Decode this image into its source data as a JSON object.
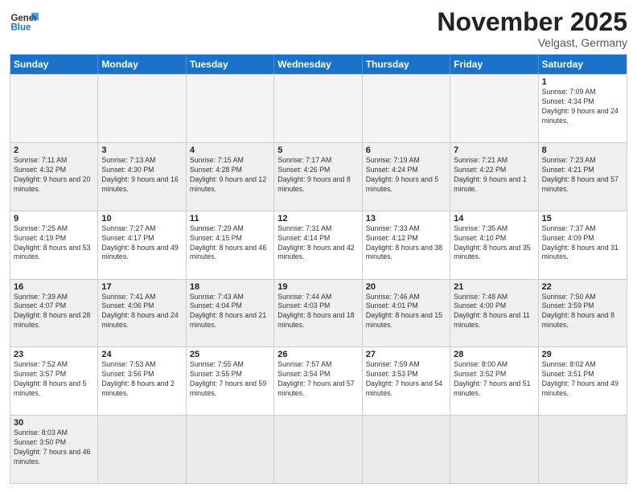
{
  "logo": {
    "general": "General",
    "blue": "Blue"
  },
  "header": {
    "month": "November 2025",
    "location": "Velgast, Germany"
  },
  "days_of_week": [
    "Sunday",
    "Monday",
    "Tuesday",
    "Wednesday",
    "Thursday",
    "Friday",
    "Saturday"
  ],
  "weeks": [
    [
      {
        "day": "",
        "info": ""
      },
      {
        "day": "",
        "info": ""
      },
      {
        "day": "",
        "info": ""
      },
      {
        "day": "",
        "info": ""
      },
      {
        "day": "",
        "info": ""
      },
      {
        "day": "",
        "info": ""
      },
      {
        "day": "1",
        "info": "Sunrise: 7:09 AM\nSunset: 4:34 PM\nDaylight: 9 hours and 24 minutes."
      }
    ],
    [
      {
        "day": "2",
        "info": "Sunrise: 7:11 AM\nSunset: 4:32 PM\nDaylight: 9 hours and 20 minutes."
      },
      {
        "day": "3",
        "info": "Sunrise: 7:13 AM\nSunset: 4:30 PM\nDaylight: 9 hours and 16 minutes."
      },
      {
        "day": "4",
        "info": "Sunrise: 7:15 AM\nSunset: 4:28 PM\nDaylight: 9 hours and 12 minutes."
      },
      {
        "day": "5",
        "info": "Sunrise: 7:17 AM\nSunset: 4:26 PM\nDaylight: 9 hours and 8 minutes."
      },
      {
        "day": "6",
        "info": "Sunrise: 7:19 AM\nSunset: 4:24 PM\nDaylight: 9 hours and 5 minutes."
      },
      {
        "day": "7",
        "info": "Sunrise: 7:21 AM\nSunset: 4:22 PM\nDaylight: 9 hours and 1 minute."
      },
      {
        "day": "8",
        "info": "Sunrise: 7:23 AM\nSunset: 4:21 PM\nDaylight: 8 hours and 57 minutes."
      }
    ],
    [
      {
        "day": "9",
        "info": "Sunrise: 7:25 AM\nSunset: 4:19 PM\nDaylight: 8 hours and 53 minutes."
      },
      {
        "day": "10",
        "info": "Sunrise: 7:27 AM\nSunset: 4:17 PM\nDaylight: 8 hours and 49 minutes."
      },
      {
        "day": "11",
        "info": "Sunrise: 7:29 AM\nSunset: 4:15 PM\nDaylight: 8 hours and 46 minutes."
      },
      {
        "day": "12",
        "info": "Sunrise: 7:31 AM\nSunset: 4:14 PM\nDaylight: 8 hours and 42 minutes."
      },
      {
        "day": "13",
        "info": "Sunrise: 7:33 AM\nSunset: 4:12 PM\nDaylight: 8 hours and 38 minutes."
      },
      {
        "day": "14",
        "info": "Sunrise: 7:35 AM\nSunset: 4:10 PM\nDaylight: 8 hours and 35 minutes."
      },
      {
        "day": "15",
        "info": "Sunrise: 7:37 AM\nSunset: 4:09 PM\nDaylight: 8 hours and 31 minutes."
      }
    ],
    [
      {
        "day": "16",
        "info": "Sunrise: 7:39 AM\nSunset: 4:07 PM\nDaylight: 8 hours and 28 minutes."
      },
      {
        "day": "17",
        "info": "Sunrise: 7:41 AM\nSunset: 4:06 PM\nDaylight: 8 hours and 24 minutes."
      },
      {
        "day": "18",
        "info": "Sunrise: 7:43 AM\nSunset: 4:04 PM\nDaylight: 8 hours and 21 minutes."
      },
      {
        "day": "19",
        "info": "Sunrise: 7:44 AM\nSunset: 4:03 PM\nDaylight: 8 hours and 18 minutes."
      },
      {
        "day": "20",
        "info": "Sunrise: 7:46 AM\nSunset: 4:01 PM\nDaylight: 8 hours and 15 minutes."
      },
      {
        "day": "21",
        "info": "Sunrise: 7:48 AM\nSunset: 4:00 PM\nDaylight: 8 hours and 11 minutes."
      },
      {
        "day": "22",
        "info": "Sunrise: 7:50 AM\nSunset: 3:59 PM\nDaylight: 8 hours and 8 minutes."
      }
    ],
    [
      {
        "day": "23",
        "info": "Sunrise: 7:52 AM\nSunset: 3:57 PM\nDaylight: 8 hours and 5 minutes."
      },
      {
        "day": "24",
        "info": "Sunrise: 7:53 AM\nSunset: 3:56 PM\nDaylight: 8 hours and 2 minutes."
      },
      {
        "day": "25",
        "info": "Sunrise: 7:55 AM\nSunset: 3:55 PM\nDaylight: 7 hours and 59 minutes."
      },
      {
        "day": "26",
        "info": "Sunrise: 7:57 AM\nSunset: 3:54 PM\nDaylight: 7 hours and 57 minutes."
      },
      {
        "day": "27",
        "info": "Sunrise: 7:59 AM\nSunset: 3:53 PM\nDaylight: 7 hours and 54 minutes."
      },
      {
        "day": "28",
        "info": "Sunrise: 8:00 AM\nSunset: 3:52 PM\nDaylight: 7 hours and 51 minutes."
      },
      {
        "day": "29",
        "info": "Sunrise: 8:02 AM\nSunset: 3:51 PM\nDaylight: 7 hours and 49 minutes."
      }
    ],
    [
      {
        "day": "30",
        "info": "Sunrise: 8:03 AM\nSunset: 3:50 PM\nDaylight: 7 hours and 46 minutes."
      },
      {
        "day": "",
        "info": ""
      },
      {
        "day": "",
        "info": ""
      },
      {
        "day": "",
        "info": ""
      },
      {
        "day": "",
        "info": ""
      },
      {
        "day": "",
        "info": ""
      },
      {
        "day": "",
        "info": ""
      }
    ]
  ]
}
